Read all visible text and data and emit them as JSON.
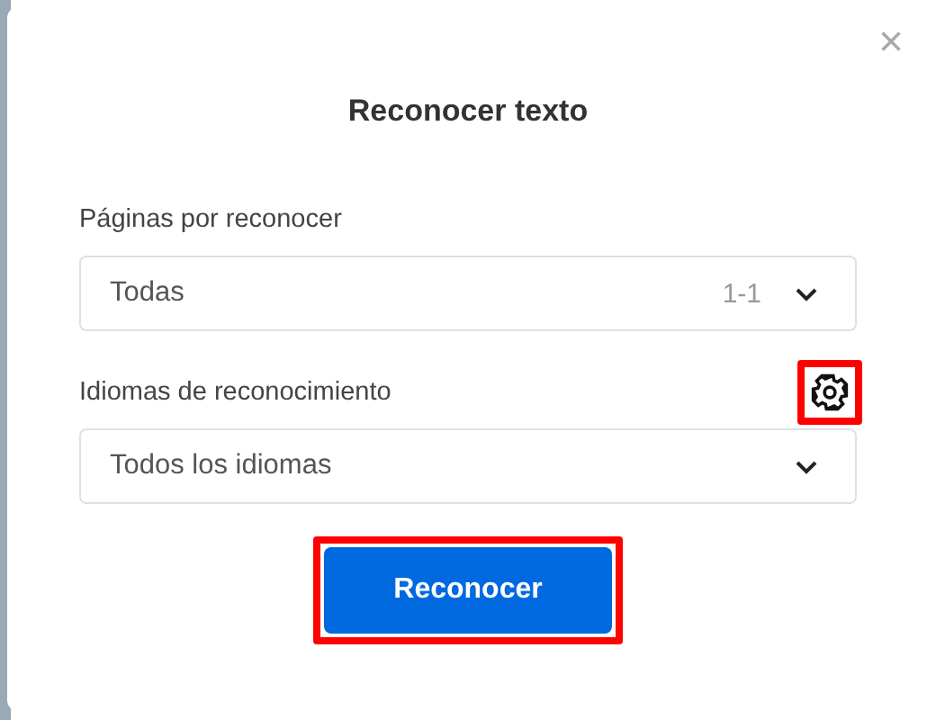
{
  "dialog": {
    "title": "Reconocer texto",
    "close": "×"
  },
  "fields": [
    {
      "label": "Páginas por reconocer",
      "value": "Todas",
      "range": "1-1"
    },
    {
      "label": "Idiomas de reconocimiento",
      "value": "Todos los idiomas",
      "has_settings": true,
      "highlighted": true
    }
  ],
  "button": {
    "label": "Reconocer",
    "highlighted": true
  }
}
